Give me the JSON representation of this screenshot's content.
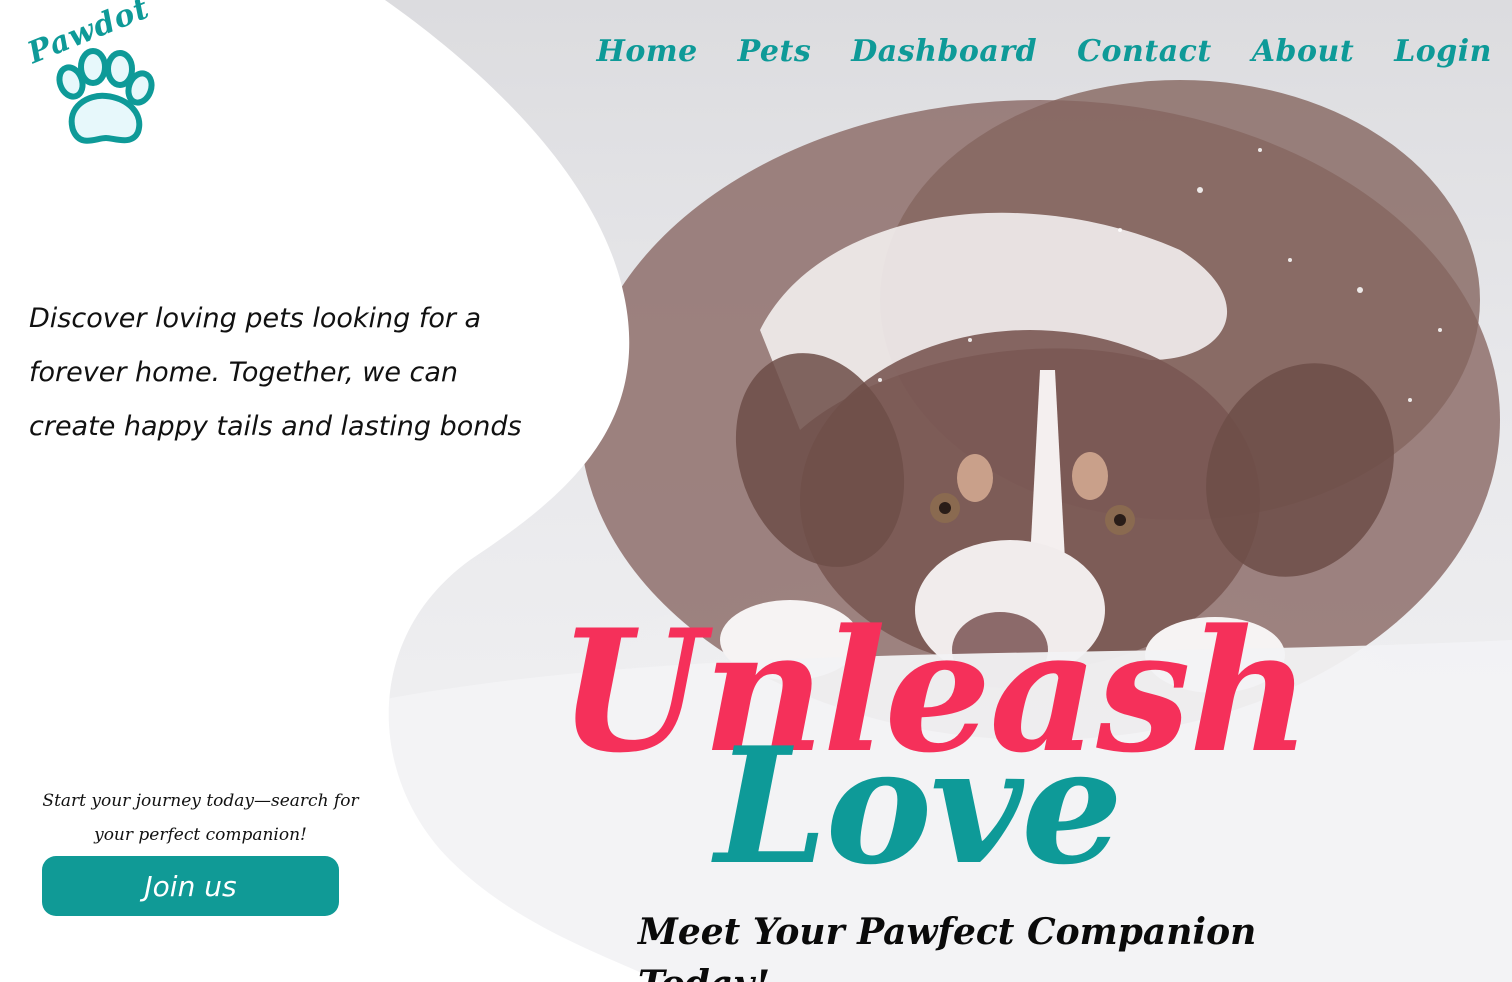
{
  "brand": {
    "logo_text": "Pawdot",
    "teal": "#0e9a98",
    "pink": "#f5305a"
  },
  "nav": {
    "items": [
      {
        "label": "Home"
      },
      {
        "label": "Pets"
      },
      {
        "label": "Dashboard"
      },
      {
        "label": "Contact"
      },
      {
        "label": "About"
      },
      {
        "label": "Login"
      }
    ]
  },
  "hero": {
    "intro": "Discover loving pets looking for a forever home. Together, we can create happy tails and lasting bonds",
    "cta_text": "Start your journey today—search for your perfect companion!",
    "join_label": "Join us",
    "headline_1": "Unleash",
    "headline_2": "Love",
    "tagline": "Meet Your Pawfect Companion Today!",
    "image": "dog-in-snow-photo"
  }
}
